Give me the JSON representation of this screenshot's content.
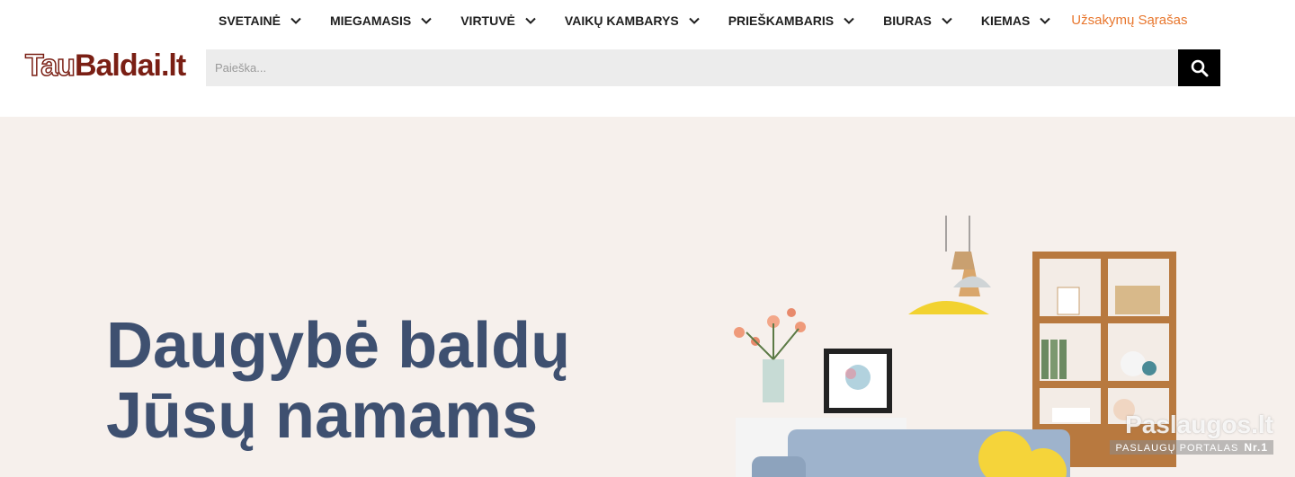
{
  "nav": {
    "items": [
      {
        "label": "SVETAINĖ"
      },
      {
        "label": "MIEGAMASIS"
      },
      {
        "label": "VIRTUVĖ"
      },
      {
        "label": "VAIKŲ KAMBARYS"
      },
      {
        "label": "PRIEŠKAMBARIS"
      },
      {
        "label": "BIURAS"
      },
      {
        "label": "KIEMAS"
      }
    ],
    "wishlist_label": "Užsakymų Sąrašas"
  },
  "logo": {
    "part1": "Tau",
    "part2": "Baldai.lt"
  },
  "search": {
    "placeholder": "Paieška...",
    "icon": "search-icon"
  },
  "hero": {
    "line1": "Daugybė baldų",
    "line2": "Jūsų namams"
  },
  "watermark": {
    "main": "Paslaugos.lt",
    "sub": "PASLAUGŲ PORTALAS",
    "badge": "Nr.1"
  },
  "colors": {
    "accent": "#e8772e",
    "hero_bg": "#f6f0ec",
    "hero_text": "#3e5070",
    "logo": "#7a1f14"
  }
}
